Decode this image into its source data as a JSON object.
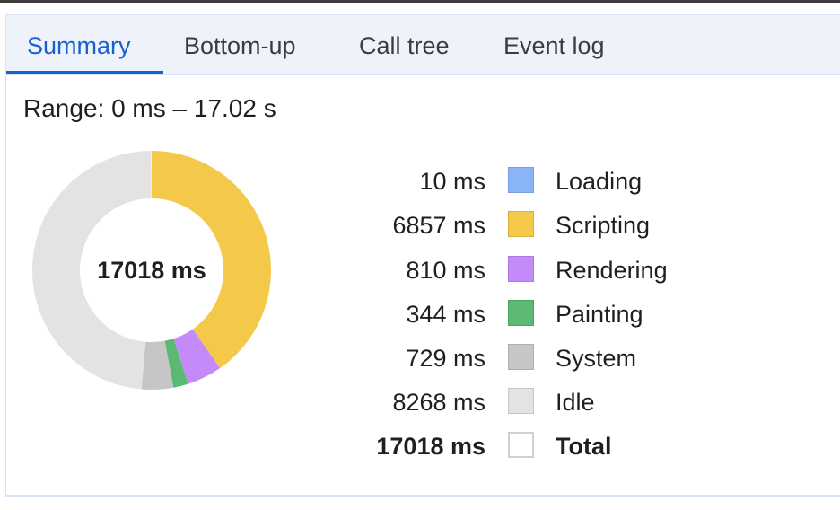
{
  "tabs": [
    {
      "label": "Summary",
      "active": true
    },
    {
      "label": "Bottom-up",
      "active": false
    },
    {
      "label": "Call tree",
      "active": false
    },
    {
      "label": "Event log",
      "active": false
    }
  ],
  "range_label": "Range: 0 ms – 17.02 s",
  "donut": {
    "center_label": "17018 ms",
    "start": "12 o'clock",
    "direction": "clockwise",
    "order": [
      "Scripting",
      "Rendering",
      "Painting",
      "System",
      "Idle"
    ]
  },
  "legend": [
    {
      "value": "10 ms",
      "label": "Loading",
      "ms": 10,
      "color": "#8ab4f8"
    },
    {
      "value": "6857 ms",
      "label": "Scripting",
      "ms": 6857,
      "color": "#f4c94a"
    },
    {
      "value": "810 ms",
      "label": "Rendering",
      "ms": 810,
      "color": "#c58af9"
    },
    {
      "value": "344 ms",
      "label": "Painting",
      "ms": 344,
      "color": "#5bb974"
    },
    {
      "value": "729 ms",
      "label": "System",
      "ms": 729,
      "color": "#c6c6c6"
    },
    {
      "value": "8268 ms",
      "label": "Idle",
      "ms": 8268,
      "color": "#e3e3e3"
    }
  ],
  "total": {
    "value": "17018 ms",
    "label": "Total",
    "ms": 17018,
    "color": "#ffffff"
  }
}
